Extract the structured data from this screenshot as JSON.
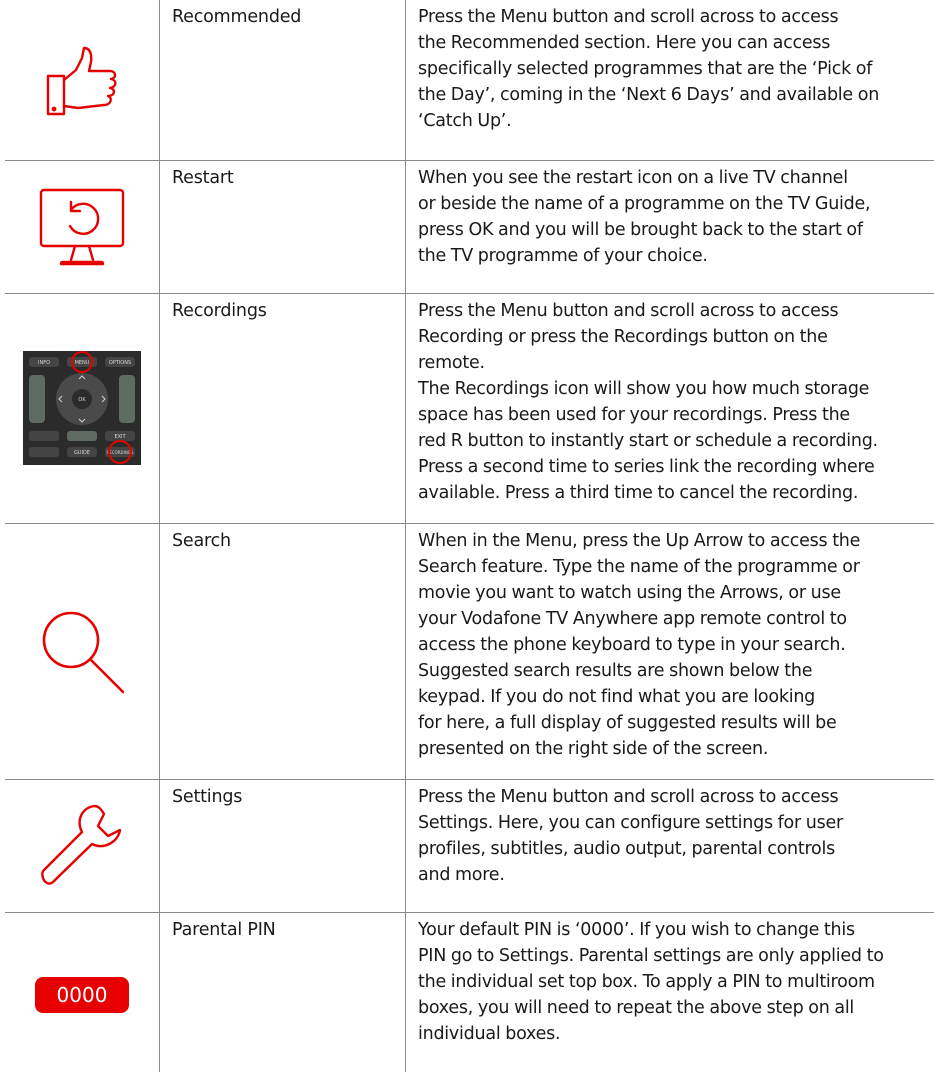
{
  "colors": {
    "accent": "#e60000",
    "border": "#8a8a8a",
    "text": "#1a1a1a"
  },
  "rows": [
    {
      "icon": "thumbs-up-icon",
      "name": "Recommended",
      "lines": [
        "Press the Menu button and scroll across to access",
        "the Recommended section. Here you can access",
        "specifically selected programmes that are the ‘Pick of",
        "the Day’, coming in the ‘Next 6 Days’ and available on",
        "‘Catch Up’."
      ]
    },
    {
      "icon": "restart-tv-icon",
      "name": "Restart",
      "lines": [
        "When you see the restart icon on a live TV channel",
        "or beside the name of a programme on the TV Guide,",
        "press OK and you will be brought back to the start of",
        "the TV programme of your choice."
      ]
    },
    {
      "icon": "remote-control-image",
      "name": "Recordings",
      "remote_labels": {
        "info": "INFO",
        "menu": "MENU",
        "options": "OPTIONS",
        "ok": "OK",
        "exit": "EXIT",
        "guide": "GUIDE",
        "recordings": "RECORDINGS"
      },
      "lines": [
        "Press the Menu button and scroll across to access",
        "Recording or press the Recordings button on the",
        "remote.",
        "The Recordings icon will show you how much storage",
        "space has been used for your recordings. Press the",
        "red R button to instantly start or schedule a recording.",
        "Press a second time to series link the recording where",
        "available. Press a third time to cancel the recording."
      ]
    },
    {
      "icon": "search-icon",
      "name": "Search",
      "lines": [
        "When in the Menu, press the Up Arrow to access the",
        "Search feature. Type the name of the programme or",
        "movie you want to watch using the Arrows, or use",
        "your Vodafone TV Anywhere app remote control to",
        "access the phone keyboard to type in your search.",
        "Suggested search results are shown below the",
        "keypad. If you do not find what you are looking",
        "for here, a full display of suggested results will be",
        "presented on the right side of the screen."
      ]
    },
    {
      "icon": "wrench-icon",
      "name": "Settings",
      "lines": [
        "Press the Menu button and scroll across to access",
        "Settings. Here, you can configure settings for user",
        "profiles, subtitles, audio output, parental controls",
        "and more."
      ]
    },
    {
      "icon": "pin-badge",
      "name": "Parental PIN",
      "badge": "0000",
      "lines": [
        "Your default PIN is ‘0000’. If you wish to change this",
        "PIN go to Settings. Parental settings are only applied to",
        "the individual set top box. To apply a PIN to multiroom",
        "boxes, you will need to repeat the above step on all",
        "individual boxes."
      ]
    }
  ]
}
